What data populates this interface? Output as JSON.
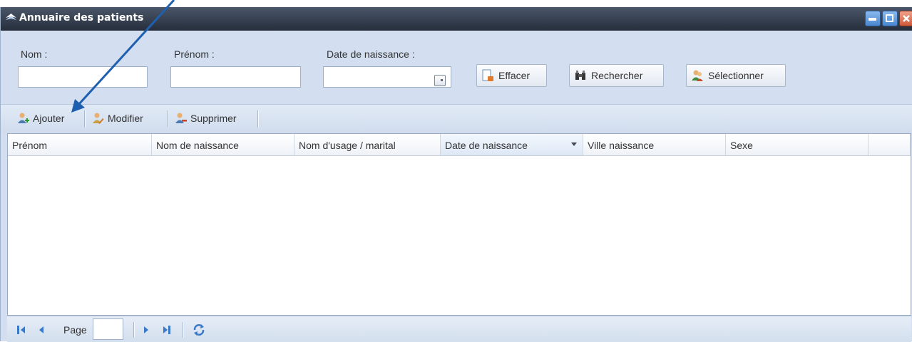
{
  "window": {
    "title": "Annuaire des patients"
  },
  "search_form": {
    "nom_label": "Nom :",
    "nom_value": "",
    "prenom_label": "Prénom :",
    "prenom_value": "",
    "date_label": "Date de naissance :",
    "date_value": "",
    "effacer_label": "Effacer",
    "rechercher_label": "Rechercher",
    "selectionner_label": "Sélectionner"
  },
  "toolbar": {
    "ajouter_label": "Ajouter",
    "modifier_label": "Modifier",
    "supprimer_label": "Supprimer"
  },
  "grid": {
    "columns": [
      "Prénom",
      "Nom de naissance",
      "Nom d'usage / marital",
      "Date de naissance",
      "Ville naissance",
      "Sexe",
      ""
    ],
    "sorted_column": "Date de naissance",
    "rows": []
  },
  "pager": {
    "page_label": "Page",
    "page_value": ""
  },
  "colors": {
    "accent": "#3a78c8",
    "titlebar": "#2f3848",
    "annotation_arrow": "#1f5fb0"
  },
  "icons": {
    "title": "app-logo-icon",
    "effacer": "eraser-icon",
    "rechercher": "binoculars-icon",
    "selectionner": "users-icon",
    "ajouter": "user-add-icon",
    "modifier": "user-edit-icon",
    "supprimer": "user-delete-icon"
  }
}
